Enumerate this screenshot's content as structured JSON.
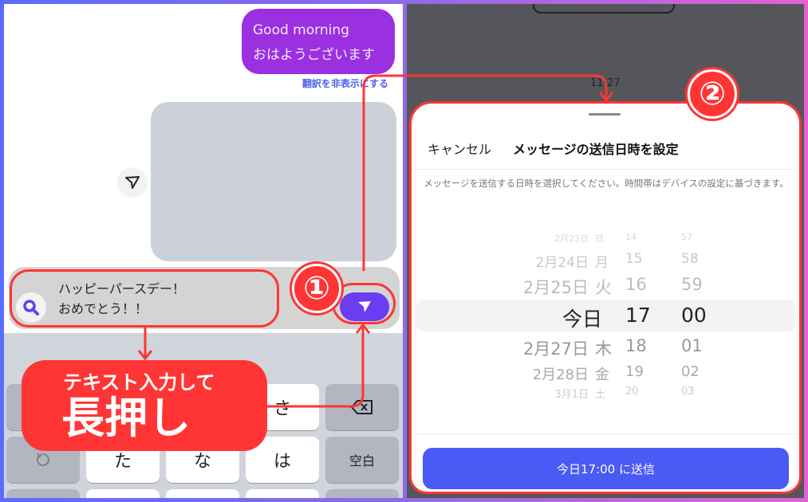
{
  "left": {
    "message": {
      "en": "Good morning",
      "ja": "おはようございます"
    },
    "translate_link": "翻訳を非表示にする",
    "input_text": [
      "ハッピーパースデー！",
      "おめでとう！！"
    ],
    "keyboard": {
      "row1": [
        "",
        "",
        "",
        "さ",
        "delete"
      ],
      "row2": [
        "undo",
        "た",
        "な",
        "は",
        "空白"
      ]
    }
  },
  "annotations": {
    "step1": "①",
    "step2": "②",
    "callout_small": "テキスト入力して",
    "callout_big": "長押し",
    "accent": "#ff3535"
  },
  "right": {
    "time": "11:27",
    "cancel": "キャンセル",
    "title": "メッセージの送信日時を設定",
    "description": "メッセージを送信する日時を選択してください。時間帯はデバイスの設定に基づきます。",
    "picker": [
      {
        "date": "2月23日",
        "dow": "日",
        "hour": "14",
        "min": "57"
      },
      {
        "date": "2月24日",
        "dow": "月",
        "hour": "15",
        "min": "58"
      },
      {
        "date": "2月25日",
        "dow": "火",
        "hour": "16",
        "min": "59"
      },
      {
        "date": "今日",
        "dow": "",
        "hour": "17",
        "min": "00",
        "selected": true
      },
      {
        "date": "2月27日",
        "dow": "木",
        "hour": "18",
        "min": "01"
      },
      {
        "date": "2月28日",
        "dow": "金",
        "hour": "19",
        "min": "02"
      },
      {
        "date": "3月1日",
        "dow": "土",
        "hour": "20",
        "min": "03"
      }
    ],
    "send_button": "今日17:00 に送信",
    "button_color": "#4a5af5"
  }
}
